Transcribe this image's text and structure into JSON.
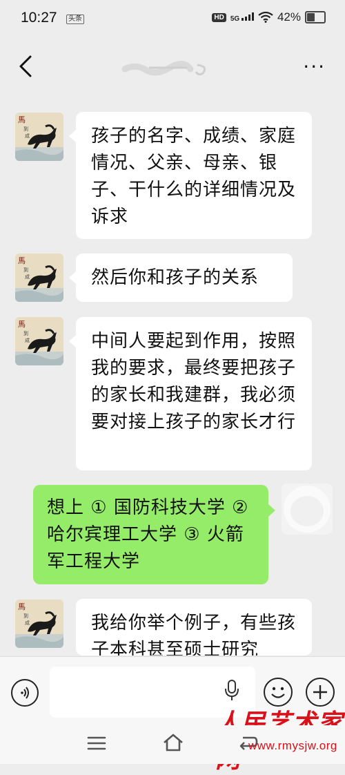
{
  "status_bar": {
    "time": "10:27",
    "app_badge": "头条",
    "hd": "HD",
    "network": "5G",
    "battery": "42%"
  },
  "header": {
    "title": "",
    "more": "···"
  },
  "messages": [
    {
      "side": "left",
      "text": "孩子的名字、成绩、家庭情况、父亲、母亲、银子、干什么的详细情况及诉求"
    },
    {
      "side": "left",
      "text": "然后你和孩子的关系"
    },
    {
      "side": "left",
      "text": "中间人要起到作用，按照我的要求，最终要把孩子的家长和我建群，我必须要对接上孩子的家长才行"
    },
    {
      "side": "right",
      "text": "想上 ① 国防科技大学 ② 哈尔宾理工大学 ③ 火箭军工程大学"
    },
    {
      "side": "left",
      "text": "我给你举个例子，有些孩子本科甚至硕士研究"
    }
  ],
  "input": {
    "placeholder": ""
  },
  "watermark": {
    "logo": "人民艺术家网",
    "url": "www.rmysjw.org"
  },
  "colors": {
    "background": "#ededed",
    "my_bubble": "#95ec69",
    "other_bubble": "#ffffff",
    "watermark": "#d8111a"
  }
}
